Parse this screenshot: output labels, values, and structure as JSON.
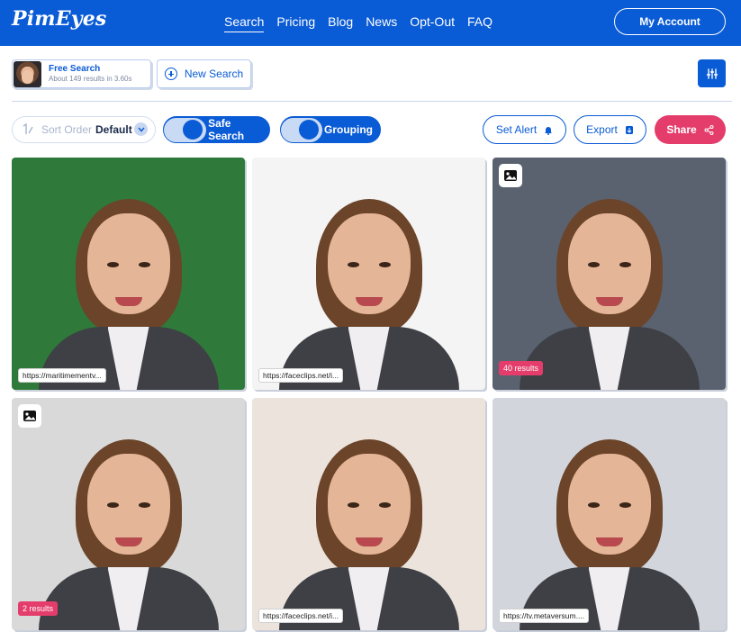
{
  "header": {
    "logo": "PimEyes",
    "nav": [
      "Search",
      "Pricing",
      "Blog",
      "News",
      "Opt-Out",
      "FAQ"
    ],
    "active_nav": "Search",
    "account_label": "My Account"
  },
  "search": {
    "title": "Free Search",
    "subtitle": "About 149 results in 3.60s",
    "new_search_label": "New Search"
  },
  "toolbar": {
    "sort_label": "Sort Order",
    "sort_value": "Default",
    "safe_search_label": "Safe Search",
    "grouping_label": "Grouping",
    "set_alert_label": "Set Alert",
    "export_label": "Export",
    "share_label": "Share"
  },
  "results": [
    {
      "url": "https://maritimementv...",
      "count": "",
      "has_image_icon": false,
      "bg": "#2f7a3a"
    },
    {
      "url": "https://faceclips.net/i...",
      "count": "",
      "has_image_icon": false,
      "bg": "#f4f4f4"
    },
    {
      "url": "",
      "count": "40 results",
      "has_image_icon": true,
      "bg": "#5a6270"
    },
    {
      "url": "",
      "count": "2 results",
      "has_image_icon": true,
      "bg": "#d9d9d9"
    },
    {
      "url": "https://faceclips.net/i...",
      "count": "",
      "has_image_icon": false,
      "bg": "#ece4dc"
    },
    {
      "url": "https://tv.metaversum....",
      "count": "",
      "has_image_icon": false,
      "bg": "#d2d6dc"
    }
  ],
  "colors": {
    "brand": "#0a5bd6",
    "share": "#e43d6b"
  }
}
